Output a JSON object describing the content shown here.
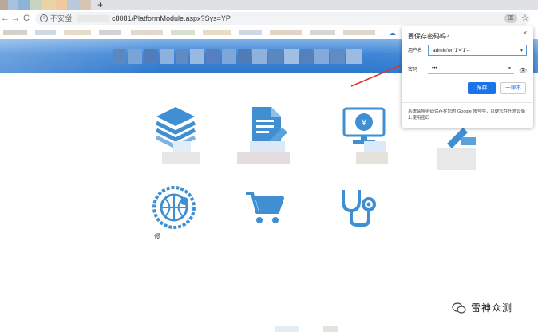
{
  "browser": {
    "new_tab_symbol": "+",
    "nav_back": "←",
    "nav_forward": "→",
    "nav_reload": "C",
    "security_label": "不安全",
    "url": "c8081/PlatformModule.aspx?Sys=YP",
    "icons": [
      "info-icon",
      "key-icon",
      "star-icon",
      "cloud-icon"
    ]
  },
  "password_popup": {
    "title": "要保存密码吗？",
    "close": "×",
    "username_label": "用户名",
    "username_value": "admin'or '1'='1'--",
    "password_label": "密码",
    "password_value": "•••",
    "eye_icon": "eye-icon",
    "save_button": "保存",
    "never_button": "一律不",
    "footer": "系统会将密码保存在您的 Google 帐号中，以便您在任意设备上使用密码"
  },
  "page": {
    "stray_text": "侵",
    "modules": [
      {
        "icon": "layers-icon"
      },
      {
        "icon": "document-icon"
      },
      {
        "icon": "monitor-yuan-icon"
      },
      {
        "icon": "tools-icon"
      },
      {
        "icon": "basketball-icon"
      },
      {
        "icon": "shopping-cart-icon"
      },
      {
        "icon": "stethoscope-icon"
      }
    ]
  },
  "watermark": {
    "text": "雷神众测",
    "icon": "wechat-logo-icon"
  },
  "colors": {
    "icon_blue": "#3f8fd2",
    "banner_blue": "#3f86d6",
    "button_blue": "#1a73e8",
    "arrow_red": "#e0342b"
  }
}
